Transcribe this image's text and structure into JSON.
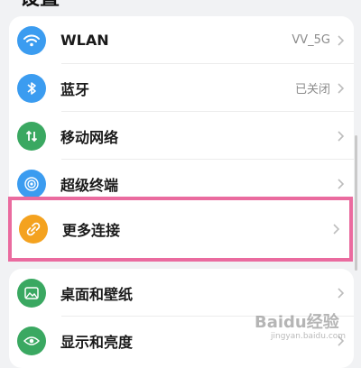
{
  "page": {
    "title": "设置"
  },
  "settings_group_1": [
    {
      "label": "WLAN",
      "value": "VV_5G",
      "icon": "wifi-icon",
      "icon_color": "#3b9cf0"
    },
    {
      "label": "蓝牙",
      "value": "已关闭",
      "icon": "bluetooth-icon",
      "icon_color": "#3b9cf0"
    },
    {
      "label": "移动网络",
      "value": "",
      "icon": "mobile-data-icon",
      "icon_color": "#3aa861"
    },
    {
      "label": "超级终端",
      "value": "",
      "icon": "super-device-icon",
      "icon_color": "#3b9cf0"
    }
  ],
  "highlighted_item": {
    "label": "更多连接",
    "icon": "link-icon",
    "icon_color": "#f4a21f",
    "highlight_color": "#ea6b9f"
  },
  "settings_group_2": [
    {
      "label": "桌面和壁纸",
      "icon": "wallpaper-icon",
      "icon_color": "#3aa861"
    },
    {
      "label": "显示和亮度",
      "icon": "eye-icon",
      "icon_color": "#3aa861"
    }
  ],
  "watermark": {
    "text": "Baidu经验",
    "sub": "jingyan.baidu.com"
  },
  "colors": {
    "background": "#f1f2f4",
    "card": "#ffffff",
    "chevron": "#bdbdbd"
  }
}
